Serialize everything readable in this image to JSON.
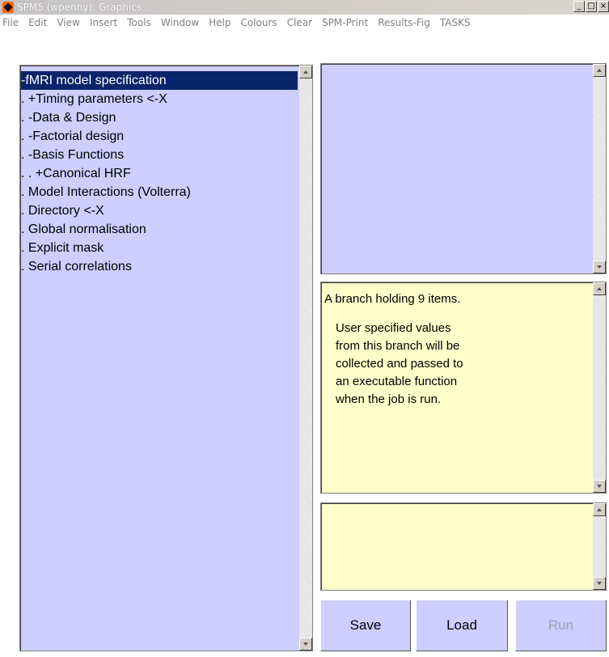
{
  "window": {
    "title": "SPM5 (wpenny): Graphics",
    "minimize": "_",
    "maximize": "□",
    "close": "×"
  },
  "menu": [
    "File",
    "Edit",
    "View",
    "Insert",
    "Tools",
    "Window",
    "Help",
    "Colours",
    "Clear",
    "SPM-Print",
    "Results-Fig",
    "TASKS"
  ],
  "tree": {
    "items": [
      "-fMRI model specification",
      ".   +Timing parameters <-X",
      ".   -Data & Design",
      ".   -Factorial design",
      ".   -Basis Functions",
      ".   .   +Canonical HRF",
      ".   Model Interactions (Volterra)",
      ".   Directory <-X",
      ".   Global normalisation",
      ".   Explicit mask",
      ".   Serial correlations"
    ],
    "selected_index": 0
  },
  "help": {
    "first_line": "A branch holding 9 items.",
    "body_lines": [
      "User specified values",
      "from this branch will be",
      "collected and passed to",
      "an executable function",
      "when the job is run."
    ]
  },
  "buttons": {
    "save": "Save",
    "load": "Load",
    "run": "Run"
  },
  "colors": {
    "panel_blue": "#cccfff",
    "panel_yellow": "#ffffcc",
    "selection": "#0a246a"
  }
}
